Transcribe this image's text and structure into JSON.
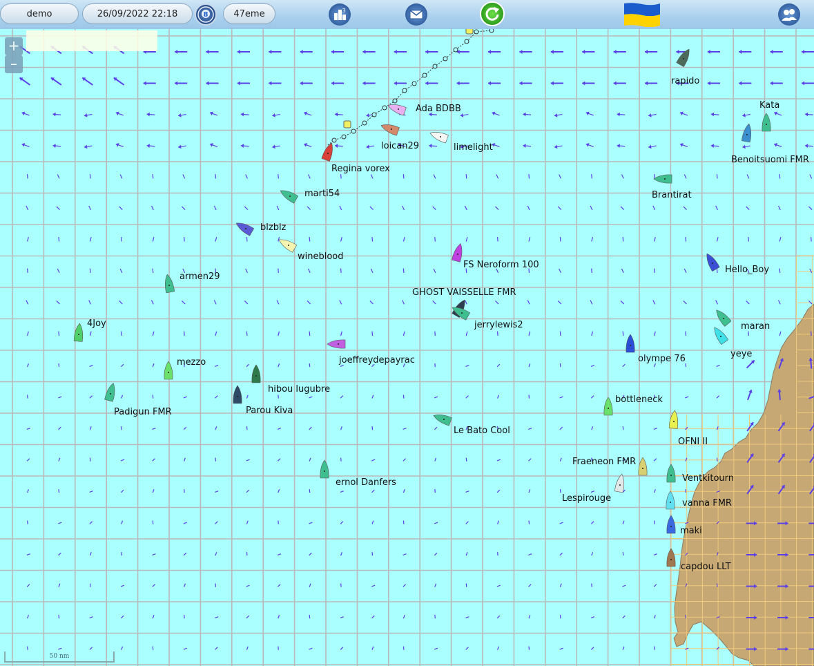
{
  "toolbar": {
    "player_name": "demo",
    "datetime": "26/09/2022 22:18",
    "clock_badge": "8",
    "rank": "47eme",
    "ranking_badge": "3",
    "icons": [
      "clock-icon",
      "ranking-icon",
      "mail-icon",
      "refresh-icon",
      "ukraine-flag",
      "players-icon"
    ],
    "flag_colors": [
      "#1a5ccc",
      "#ffd200"
    ]
  },
  "zoom": {
    "in_label": "+",
    "out_label": "–"
  },
  "scale": {
    "label": "50 nm"
  },
  "colors": {
    "sea": "#aaffff",
    "grid": "#b9b9b9",
    "land": "#c6a874",
    "wind_arrow": "#5b3fe6",
    "coast_grid": "#f0c97a"
  },
  "boats": [
    {
      "name": "rapido",
      "color": "#4d6b5a"
    },
    {
      "name": "Kata",
      "color": "#3fbf8f"
    },
    {
      "name": "Benoitsuomi FMR",
      "color": "#3a8fcf"
    },
    {
      "name": "Ada BDBB",
      "color": "#e8b0f0"
    },
    {
      "name": "loican29",
      "color": "#d48a6a"
    },
    {
      "name": "limelight",
      "color": "#f4f6f4"
    },
    {
      "name": "Regina vorex",
      "color": "#d9403a"
    },
    {
      "name": "Brantirat",
      "color": "#3fbf8f"
    },
    {
      "name": "marti54",
      "color": "#3fbf8f"
    },
    {
      "name": "blzblz",
      "color": "#5a5ad6"
    },
    {
      "name": "wineblood",
      "color": "#f4f4b0"
    },
    {
      "name": "FS Neroform 100",
      "color": "#c040e0"
    },
    {
      "name": "Hello_Boy",
      "color": "#3a4fd6"
    },
    {
      "name": "armen29",
      "color": "#3fbf8f"
    },
    {
      "name": "GHOST VAISSELLE FMR",
      "color": "#2c3e50"
    },
    {
      "name": "jerrylewis2",
      "color": "#3fbf8f"
    },
    {
      "name": "4Joy",
      "color": "#4fd06a"
    },
    {
      "name": "maran",
      "color": "#3fbf8f"
    },
    {
      "name": "yeye",
      "color": "#40e0e8"
    },
    {
      "name": "joeffreydepayrac",
      "color": "#c060e0"
    },
    {
      "name": "olympe 76",
      "color": "#2a4fd6"
    },
    {
      "name": "mezzo",
      "color": "#6ae06a"
    },
    {
      "name": "hibou lugubre",
      "color": "#2f7a4a"
    },
    {
      "name": "Parou Kiva",
      "color": "#2e4a66"
    },
    {
      "name": "Padigun FMR",
      "color": "#3fbf8f"
    },
    {
      "name": "bottleneck",
      "color": "#6ae06a"
    },
    {
      "name": "Le Bato Cool",
      "color": "#3fbf8f"
    },
    {
      "name": "OFNI II",
      "color": "#e8f050"
    },
    {
      "name": "Fraeneon FMR",
      "color": "#d8d070"
    },
    {
      "name": "ernol Danfers",
      "color": "#3fbf8f"
    },
    {
      "name": "Ventkitourn",
      "color": "#3fbf8f"
    },
    {
      "name": "Lespirouge",
      "color": "#e0e8e8"
    },
    {
      "name": "vanna FMR",
      "color": "#60e0f0"
    },
    {
      "name": "maki",
      "color": "#3a6ae0"
    },
    {
      "name": "capdou LLT",
      "color": "#a07850"
    }
  ]
}
